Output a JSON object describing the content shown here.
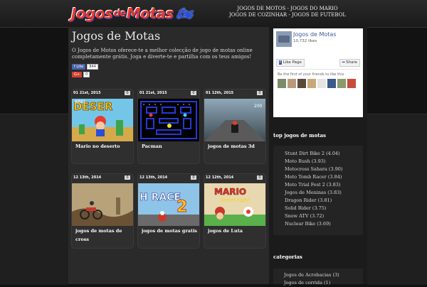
{
  "logo": {
    "text": "Jogos",
    "text2": "de",
    "text3": "Motas"
  },
  "toplinks": {
    "line1": [
      "JOGOS DE MOTOS",
      "JOGOS DO MARIO"
    ],
    "line2": [
      "JOGOS DE COZINHAR",
      "JOGOS DE FUTEBOL"
    ]
  },
  "page": {
    "title": "Jogos de Motas",
    "intro": "O Jogos de Motos oferece-te a melhor colecção de jogo de motas online completamente grátis. Joga e diverte-te e partilha com os teus amigos!"
  },
  "social": {
    "like_label": "Like",
    "like_count": "844",
    "gplus_label": "G+",
    "gplus_count": "0"
  },
  "cards": [
    {
      "date": "01 21st, 2015",
      "comments": "0",
      "title": "Mario no deserto",
      "thumb": "mario-desert"
    },
    {
      "date": "01 21st, 2015",
      "comments": "0",
      "title": "Pacman",
      "thumb": "pacman"
    },
    {
      "date": "01 12th, 2015",
      "comments": "0",
      "title": "jogos de motas 3d",
      "thumb": "moto3d"
    },
    {
      "date": "12 13th, 2014",
      "comments": "0",
      "title": "jogos de motas de cross",
      "thumb": "cross"
    },
    {
      "date": "12 13th, 2014",
      "comments": "0",
      "title": "jogos de motas gratis",
      "thumb": "gratis"
    },
    {
      "date": "12 12th, 2014",
      "comments": "0",
      "title": "jogos de Luta",
      "thumb": "luta"
    }
  ],
  "facebook": {
    "name": "Jogos de Motas",
    "likes": "10,732 likes",
    "like_page": "Like Page",
    "share": "Share",
    "friends": "Be the first of your friends to like this"
  },
  "sidebar": {
    "top_title": "top jogos de motas",
    "top_items": [
      "Stunt Dirt Bike 2 (4.04)",
      "Moto Rush (3.93)",
      "Motocross Sahara (3.90)",
      "Moto Tomb Racer (3.84)",
      "Moto Trial Fest 2 (3.83)",
      "Jogos de Meninas (3.83)",
      "Dragon Rider (3.81)",
      "Solid Rider (3.75)",
      "Snow ATV (3.72)",
      "Nuclear Bike (3.69)"
    ],
    "cat_title": "categorias",
    "cat_items": [
      "Jogos de Acrobacias (3)",
      "Jogos de corrida (1)"
    ]
  }
}
